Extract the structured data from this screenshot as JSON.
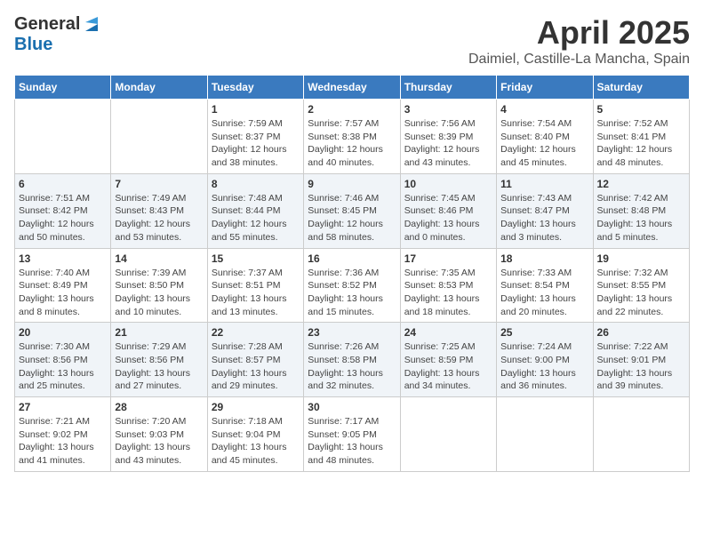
{
  "logo": {
    "general": "General",
    "blue": "Blue"
  },
  "title": "April 2025",
  "location": "Daimiel, Castille-La Mancha, Spain",
  "weekdays": [
    "Sunday",
    "Monday",
    "Tuesday",
    "Wednesday",
    "Thursday",
    "Friday",
    "Saturday"
  ],
  "weeks": [
    [
      null,
      null,
      {
        "day": 1,
        "sunrise": "7:59 AM",
        "sunset": "8:37 PM",
        "daylight": "12 hours and 38 minutes."
      },
      {
        "day": 2,
        "sunrise": "7:57 AM",
        "sunset": "8:38 PM",
        "daylight": "12 hours and 40 minutes."
      },
      {
        "day": 3,
        "sunrise": "7:56 AM",
        "sunset": "8:39 PM",
        "daylight": "12 hours and 43 minutes."
      },
      {
        "day": 4,
        "sunrise": "7:54 AM",
        "sunset": "8:40 PM",
        "daylight": "12 hours and 45 minutes."
      },
      {
        "day": 5,
        "sunrise": "7:52 AM",
        "sunset": "8:41 PM",
        "daylight": "12 hours and 48 minutes."
      }
    ],
    [
      {
        "day": 6,
        "sunrise": "7:51 AM",
        "sunset": "8:42 PM",
        "daylight": "12 hours and 50 minutes."
      },
      {
        "day": 7,
        "sunrise": "7:49 AM",
        "sunset": "8:43 PM",
        "daylight": "12 hours and 53 minutes."
      },
      {
        "day": 8,
        "sunrise": "7:48 AM",
        "sunset": "8:44 PM",
        "daylight": "12 hours and 55 minutes."
      },
      {
        "day": 9,
        "sunrise": "7:46 AM",
        "sunset": "8:45 PM",
        "daylight": "12 hours and 58 minutes."
      },
      {
        "day": 10,
        "sunrise": "7:45 AM",
        "sunset": "8:46 PM",
        "daylight": "13 hours and 0 minutes."
      },
      {
        "day": 11,
        "sunrise": "7:43 AM",
        "sunset": "8:47 PM",
        "daylight": "13 hours and 3 minutes."
      },
      {
        "day": 12,
        "sunrise": "7:42 AM",
        "sunset": "8:48 PM",
        "daylight": "13 hours and 5 minutes."
      }
    ],
    [
      {
        "day": 13,
        "sunrise": "7:40 AM",
        "sunset": "8:49 PM",
        "daylight": "13 hours and 8 minutes."
      },
      {
        "day": 14,
        "sunrise": "7:39 AM",
        "sunset": "8:50 PM",
        "daylight": "13 hours and 10 minutes."
      },
      {
        "day": 15,
        "sunrise": "7:37 AM",
        "sunset": "8:51 PM",
        "daylight": "13 hours and 13 minutes."
      },
      {
        "day": 16,
        "sunrise": "7:36 AM",
        "sunset": "8:52 PM",
        "daylight": "13 hours and 15 minutes."
      },
      {
        "day": 17,
        "sunrise": "7:35 AM",
        "sunset": "8:53 PM",
        "daylight": "13 hours and 18 minutes."
      },
      {
        "day": 18,
        "sunrise": "7:33 AM",
        "sunset": "8:54 PM",
        "daylight": "13 hours and 20 minutes."
      },
      {
        "day": 19,
        "sunrise": "7:32 AM",
        "sunset": "8:55 PM",
        "daylight": "13 hours and 22 minutes."
      }
    ],
    [
      {
        "day": 20,
        "sunrise": "7:30 AM",
        "sunset": "8:56 PM",
        "daylight": "13 hours and 25 minutes."
      },
      {
        "day": 21,
        "sunrise": "7:29 AM",
        "sunset": "8:56 PM",
        "daylight": "13 hours and 27 minutes."
      },
      {
        "day": 22,
        "sunrise": "7:28 AM",
        "sunset": "8:57 PM",
        "daylight": "13 hours and 29 minutes."
      },
      {
        "day": 23,
        "sunrise": "7:26 AM",
        "sunset": "8:58 PM",
        "daylight": "13 hours and 32 minutes."
      },
      {
        "day": 24,
        "sunrise": "7:25 AM",
        "sunset": "8:59 PM",
        "daylight": "13 hours and 34 minutes."
      },
      {
        "day": 25,
        "sunrise": "7:24 AM",
        "sunset": "9:00 PM",
        "daylight": "13 hours and 36 minutes."
      },
      {
        "day": 26,
        "sunrise": "7:22 AM",
        "sunset": "9:01 PM",
        "daylight": "13 hours and 39 minutes."
      }
    ],
    [
      {
        "day": 27,
        "sunrise": "7:21 AM",
        "sunset": "9:02 PM",
        "daylight": "13 hours and 41 minutes."
      },
      {
        "day": 28,
        "sunrise": "7:20 AM",
        "sunset": "9:03 PM",
        "daylight": "13 hours and 43 minutes."
      },
      {
        "day": 29,
        "sunrise": "7:18 AM",
        "sunset": "9:04 PM",
        "daylight": "13 hours and 45 minutes."
      },
      {
        "day": 30,
        "sunrise": "7:17 AM",
        "sunset": "9:05 PM",
        "daylight": "13 hours and 48 minutes."
      },
      null,
      null,
      null
    ]
  ]
}
